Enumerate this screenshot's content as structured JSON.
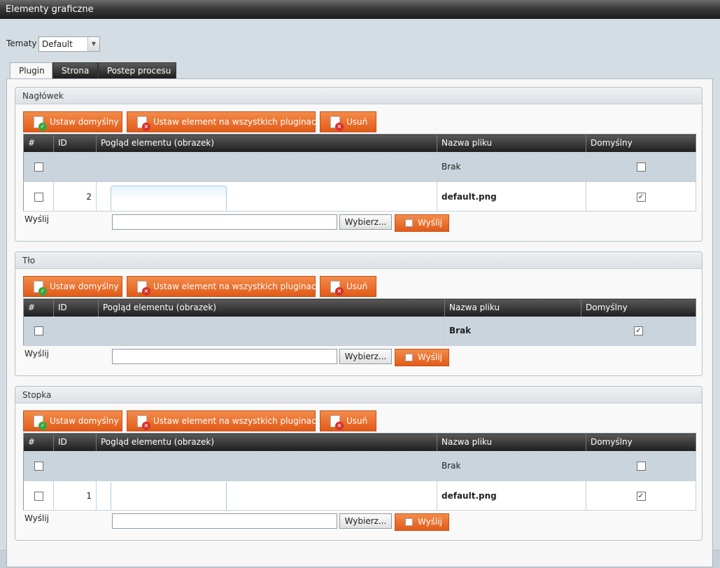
{
  "window": {
    "title": "Elementy graficzne"
  },
  "theme": {
    "label": "Tematy",
    "value": "Default"
  },
  "tabs": [
    {
      "label": "Plugin",
      "active": true
    },
    {
      "label": "Strona",
      "active": false
    },
    {
      "label": "Postep procesu",
      "active": false
    }
  ],
  "buttons": {
    "set_default": "Ustaw domyślny",
    "set_all": "Ustaw element na wszystkich pluginach",
    "delete": "Usuń"
  },
  "columns": [
    "#",
    "ID",
    "Pogląd elementu (obrazek)",
    "Nazwa pliku",
    "Domyślny"
  ],
  "upload": {
    "label": "Wyślij",
    "browse": "Wybierz...",
    "send": "Wyślij"
  },
  "sections": [
    {
      "title": "Nagłówek",
      "rows": [
        {
          "id": "",
          "filename": "Brak",
          "bold": false,
          "is_default": false,
          "highlight": true
        },
        {
          "id": "2",
          "filename": "default.png",
          "bold": true,
          "is_default": true,
          "highlight": false
        }
      ]
    },
    {
      "title": "Tło",
      "rows": [
        {
          "id": "",
          "filename": "Brak",
          "bold": true,
          "is_default": true,
          "highlight": true
        }
      ]
    },
    {
      "title": "Stopka",
      "rows": [
        {
          "id": "",
          "filename": "Brak",
          "bold": false,
          "is_default": false,
          "highlight": true
        },
        {
          "id": "1",
          "filename": "default.png",
          "bold": true,
          "is_default": true,
          "highlight": false
        }
      ]
    }
  ]
}
